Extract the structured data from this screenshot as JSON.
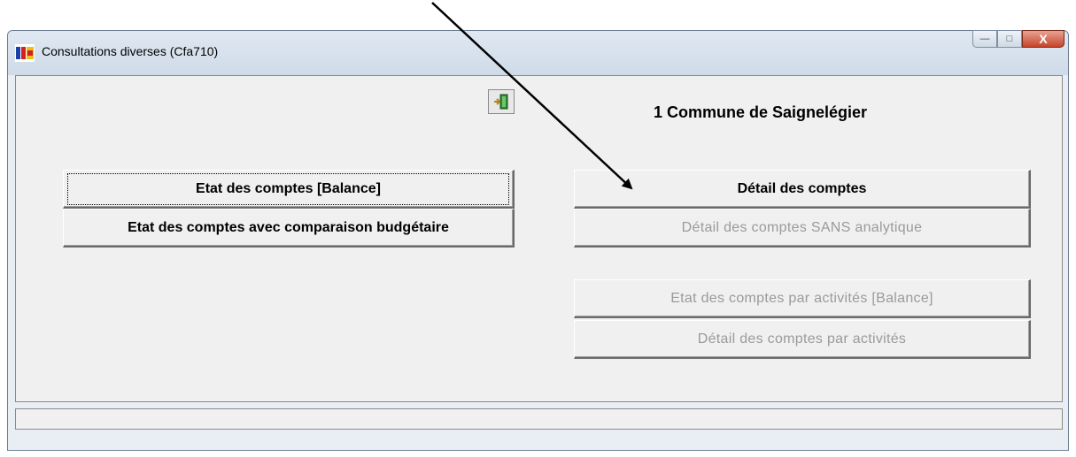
{
  "window": {
    "title": "Consultations diverses (Cfa710)",
    "caption": {
      "minimize": "—",
      "maximize": "□",
      "close": "X"
    }
  },
  "header": {
    "commune_label": "1  Commune de Saignelégier"
  },
  "buttons": {
    "etat_balance": "Etat des comptes [Balance]",
    "etat_budget": "Etat des comptes avec comparaison budgétaire",
    "detail": "Détail des comptes",
    "detail_sans": "Détail des comptes SANS analytique",
    "etat_activites": "Etat des comptes par activités [Balance]",
    "detail_activites": "Détail des comptes par activités"
  },
  "statusbar": {
    "text": ""
  },
  "colors": {
    "window_bg": "#e9eef4",
    "client_bg": "#f0f0f0",
    "disabled_text": "#9a9a9a",
    "close_red": "#c7432a"
  },
  "icons": {
    "app": "app-icon",
    "exit": "exit-door-icon",
    "annotation": "arrow-annotation-icon"
  }
}
